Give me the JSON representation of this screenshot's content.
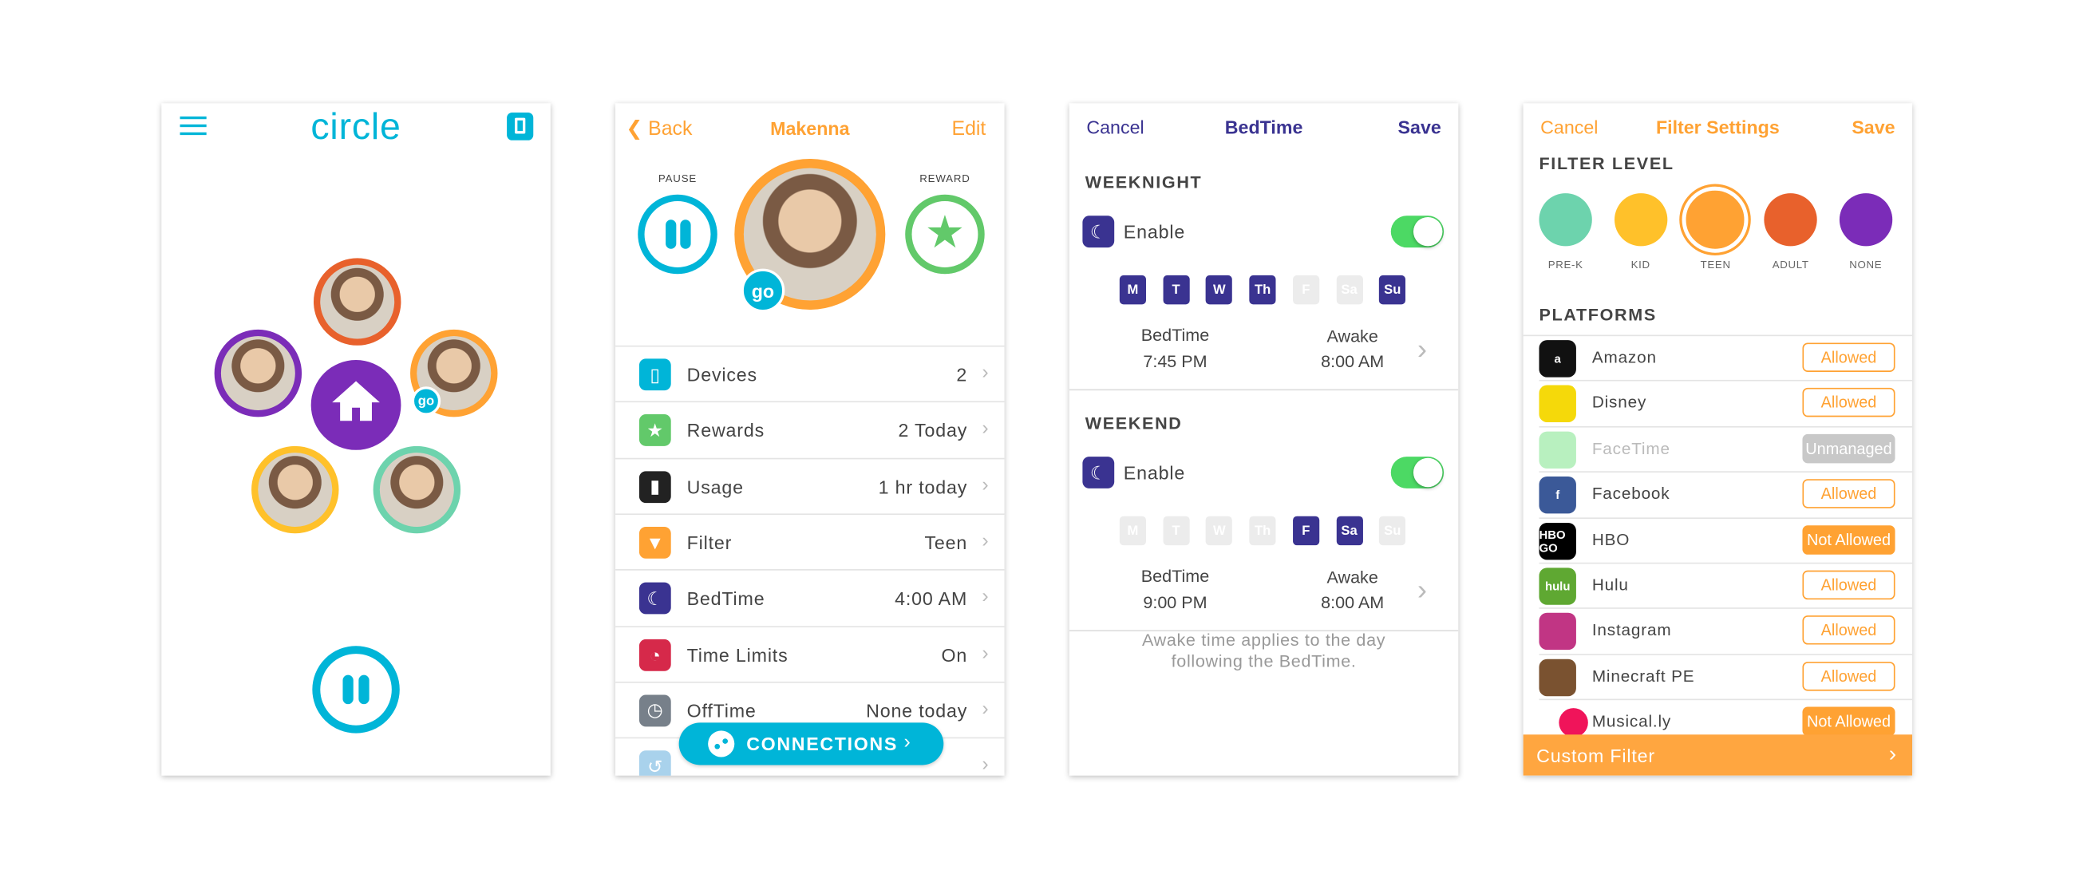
{
  "colors": {
    "cyan": "#00b5d8",
    "orange": "#ffa233",
    "purple": "#7b2cb8",
    "navy": "#3a3391",
    "green": "#4cd964",
    "star_green": "#62c96a"
  },
  "home": {
    "logo": "circle",
    "menu_icon": "hamburger-icon",
    "device_icon": "tablet-icon",
    "go_badge": "go",
    "members": [
      {
        "ring": "#e8612c"
      },
      {
        "ring": "#7b2cb8"
      },
      {
        "ring": "#ffa233",
        "go": true
      },
      {
        "ring": "#ffc12a"
      },
      {
        "ring": "#6dd3ad"
      }
    ]
  },
  "profile": {
    "back": "Back",
    "title": "Makenna",
    "edit": "Edit",
    "pause_label": "PAUSE",
    "reward_label": "REWARD",
    "go_badge": "go",
    "rows": [
      {
        "label": "Devices",
        "value": "2",
        "icon": "tablet-icon",
        "color": "#00b5d8"
      },
      {
        "label": "Rewards",
        "value": "2 Today",
        "icon": "star-icon",
        "color": "#62c96a"
      },
      {
        "label": "Usage",
        "value": "1 hr today",
        "icon": "bar-chart-icon",
        "color": "#222222"
      },
      {
        "label": "Filter",
        "value": "Teen",
        "icon": "funnel-icon",
        "color": "#ffa233"
      },
      {
        "label": "BedTime",
        "value": "4:00 AM",
        "icon": "moon-icon",
        "color": "#3a3391"
      },
      {
        "label": "Time Limits",
        "value": "On",
        "icon": "pie-clock-icon",
        "color": "#d6294a"
      },
      {
        "label": "OffTime",
        "value": "None today",
        "icon": "clock-icon",
        "color": "#77808a"
      },
      {
        "label": "",
        "value": "",
        "icon": "history-icon",
        "color": "#a9d2ec"
      }
    ],
    "connections": "CONNECTIONS"
  },
  "bedtime": {
    "cancel": "Cancel",
    "title": "BedTime",
    "save": "Save",
    "sections": [
      {
        "heading": "WEEKNIGHT",
        "enable": "Enable",
        "enabled": true,
        "days": [
          {
            "d": "M",
            "on": true
          },
          {
            "d": "T",
            "on": true
          },
          {
            "d": "W",
            "on": true
          },
          {
            "d": "Th",
            "on": true
          },
          {
            "d": "F",
            "on": false
          },
          {
            "d": "Sa",
            "on": false
          },
          {
            "d": "Su",
            "on": true
          }
        ],
        "bedtime_label": "BedTime",
        "bedtime": "7:45 PM",
        "awake_label": "Awake",
        "awake": "8:00 AM"
      },
      {
        "heading": "WEEKEND",
        "enable": "Enable",
        "enabled": true,
        "days": [
          {
            "d": "M",
            "on": false
          },
          {
            "d": "T",
            "on": false
          },
          {
            "d": "W",
            "on": false
          },
          {
            "d": "Th",
            "on": false
          },
          {
            "d": "F",
            "on": true
          },
          {
            "d": "Sa",
            "on": true
          },
          {
            "d": "Su",
            "on": false
          }
        ],
        "bedtime_label": "BedTime",
        "bedtime": "9:00 PM",
        "awake_label": "Awake",
        "awake": "8:00 AM"
      }
    ],
    "note_line1": "Awake time applies to the day",
    "note_line2": "following the BedTime."
  },
  "filter": {
    "cancel": "Cancel",
    "title": "Filter Settings",
    "save": "Save",
    "level_heading": "FILTER LEVEL",
    "selected": "TEEN",
    "levels": [
      {
        "label": "PRE-K",
        "color": "#6dd3ad"
      },
      {
        "label": "KID",
        "color": "#ffc12a"
      },
      {
        "label": "TEEN",
        "color": "#ffa233"
      },
      {
        "label": "ADULT",
        "color": "#e8612c"
      },
      {
        "label": "NONE",
        "color": "#7b2cb8"
      }
    ],
    "platforms_heading": "PLATFORMS",
    "platforms": [
      {
        "name": "Amazon",
        "status": "Allowed",
        "icon": "a",
        "bg": "#111111"
      },
      {
        "name": "Disney",
        "status": "Allowed",
        "icon": "",
        "bg": "#f5d90a"
      },
      {
        "name": "FaceTime",
        "status": "Unmanaged",
        "icon": "",
        "bg": "#b8f0bf"
      },
      {
        "name": "Facebook",
        "status": "Allowed",
        "icon": "f",
        "bg": "#3b5998"
      },
      {
        "name": "HBO",
        "status": "Not Allowed",
        "icon": "HBO GO",
        "bg": "#000000"
      },
      {
        "name": "Hulu",
        "status": "Allowed",
        "icon": "hulu",
        "bg": "#5fa832"
      },
      {
        "name": "Instagram",
        "status": "Allowed",
        "icon": "",
        "bg": "#c13584"
      },
      {
        "name": "Minecraft PE",
        "status": "Allowed",
        "icon": "",
        "bg": "#7a5230"
      },
      {
        "name": "Musical.ly",
        "status": "Not Allowed",
        "icon": "",
        "bg": "#f0145a"
      }
    ],
    "custom_filter": "Custom Filter"
  }
}
